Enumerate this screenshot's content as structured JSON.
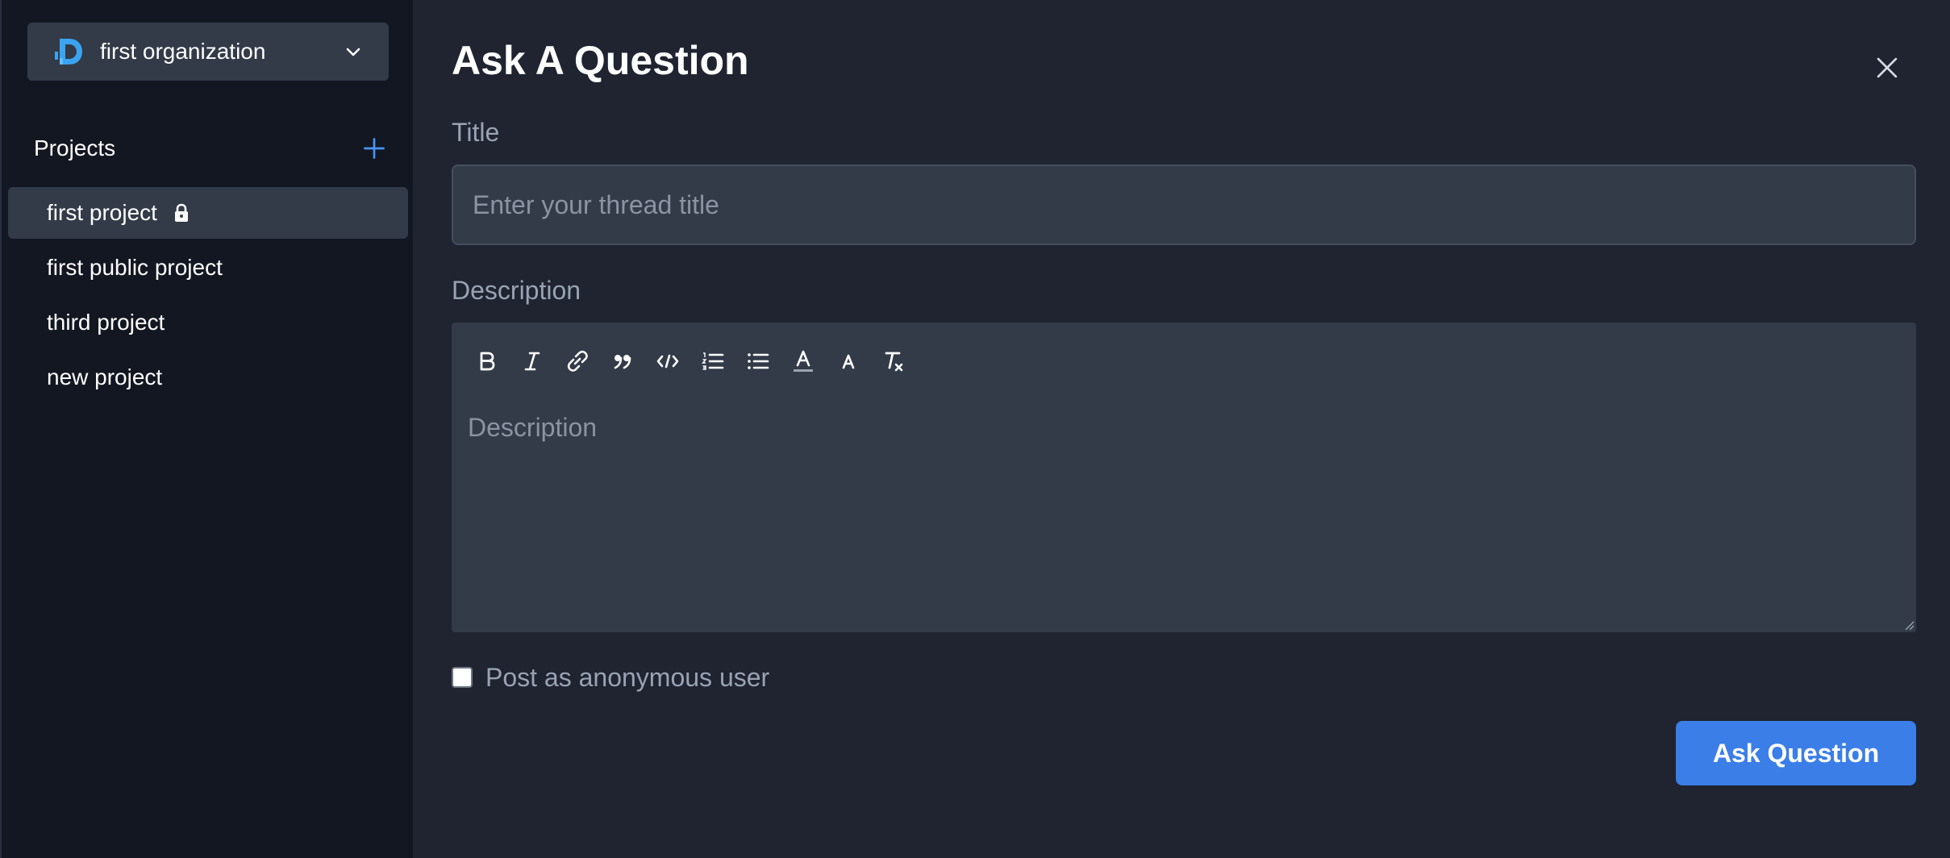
{
  "sidebar": {
    "org": {
      "name": "first organization",
      "logo_icon": "d-logo-icon",
      "chevron_icon": "chevron-down-icon"
    },
    "projects_title": "Projects",
    "add_icon": "plus-icon",
    "projects": [
      {
        "label": "first project",
        "active": true,
        "locked": true
      },
      {
        "label": "first public project",
        "active": false,
        "locked": false
      },
      {
        "label": "third project",
        "active": false,
        "locked": false
      },
      {
        "label": "new project",
        "active": false,
        "locked": false
      }
    ]
  },
  "main": {
    "title": "Ask A Question",
    "close_icon": "close-icon",
    "title_label": "Title",
    "title_placeholder": "Enter your thread title",
    "title_value": "",
    "description_label": "Description",
    "description_placeholder": "Description",
    "description_value": "",
    "toolbar": [
      "bold-icon",
      "italic-icon",
      "link-icon",
      "quote-icon",
      "code-icon",
      "ordered-list-icon",
      "bullet-list-icon",
      "text-color-icon",
      "font-size-icon",
      "clear-format-icon"
    ],
    "anonymous_label": "Post as anonymous user",
    "anonymous_checked": false,
    "submit_label": "Ask Question"
  },
  "colors": {
    "accent": "#3b7ee8",
    "sidebar_bg": "#131722",
    "main_bg": "#1f2430",
    "input_bg": "#333a48",
    "logo_blue": "#3ba4f0"
  }
}
